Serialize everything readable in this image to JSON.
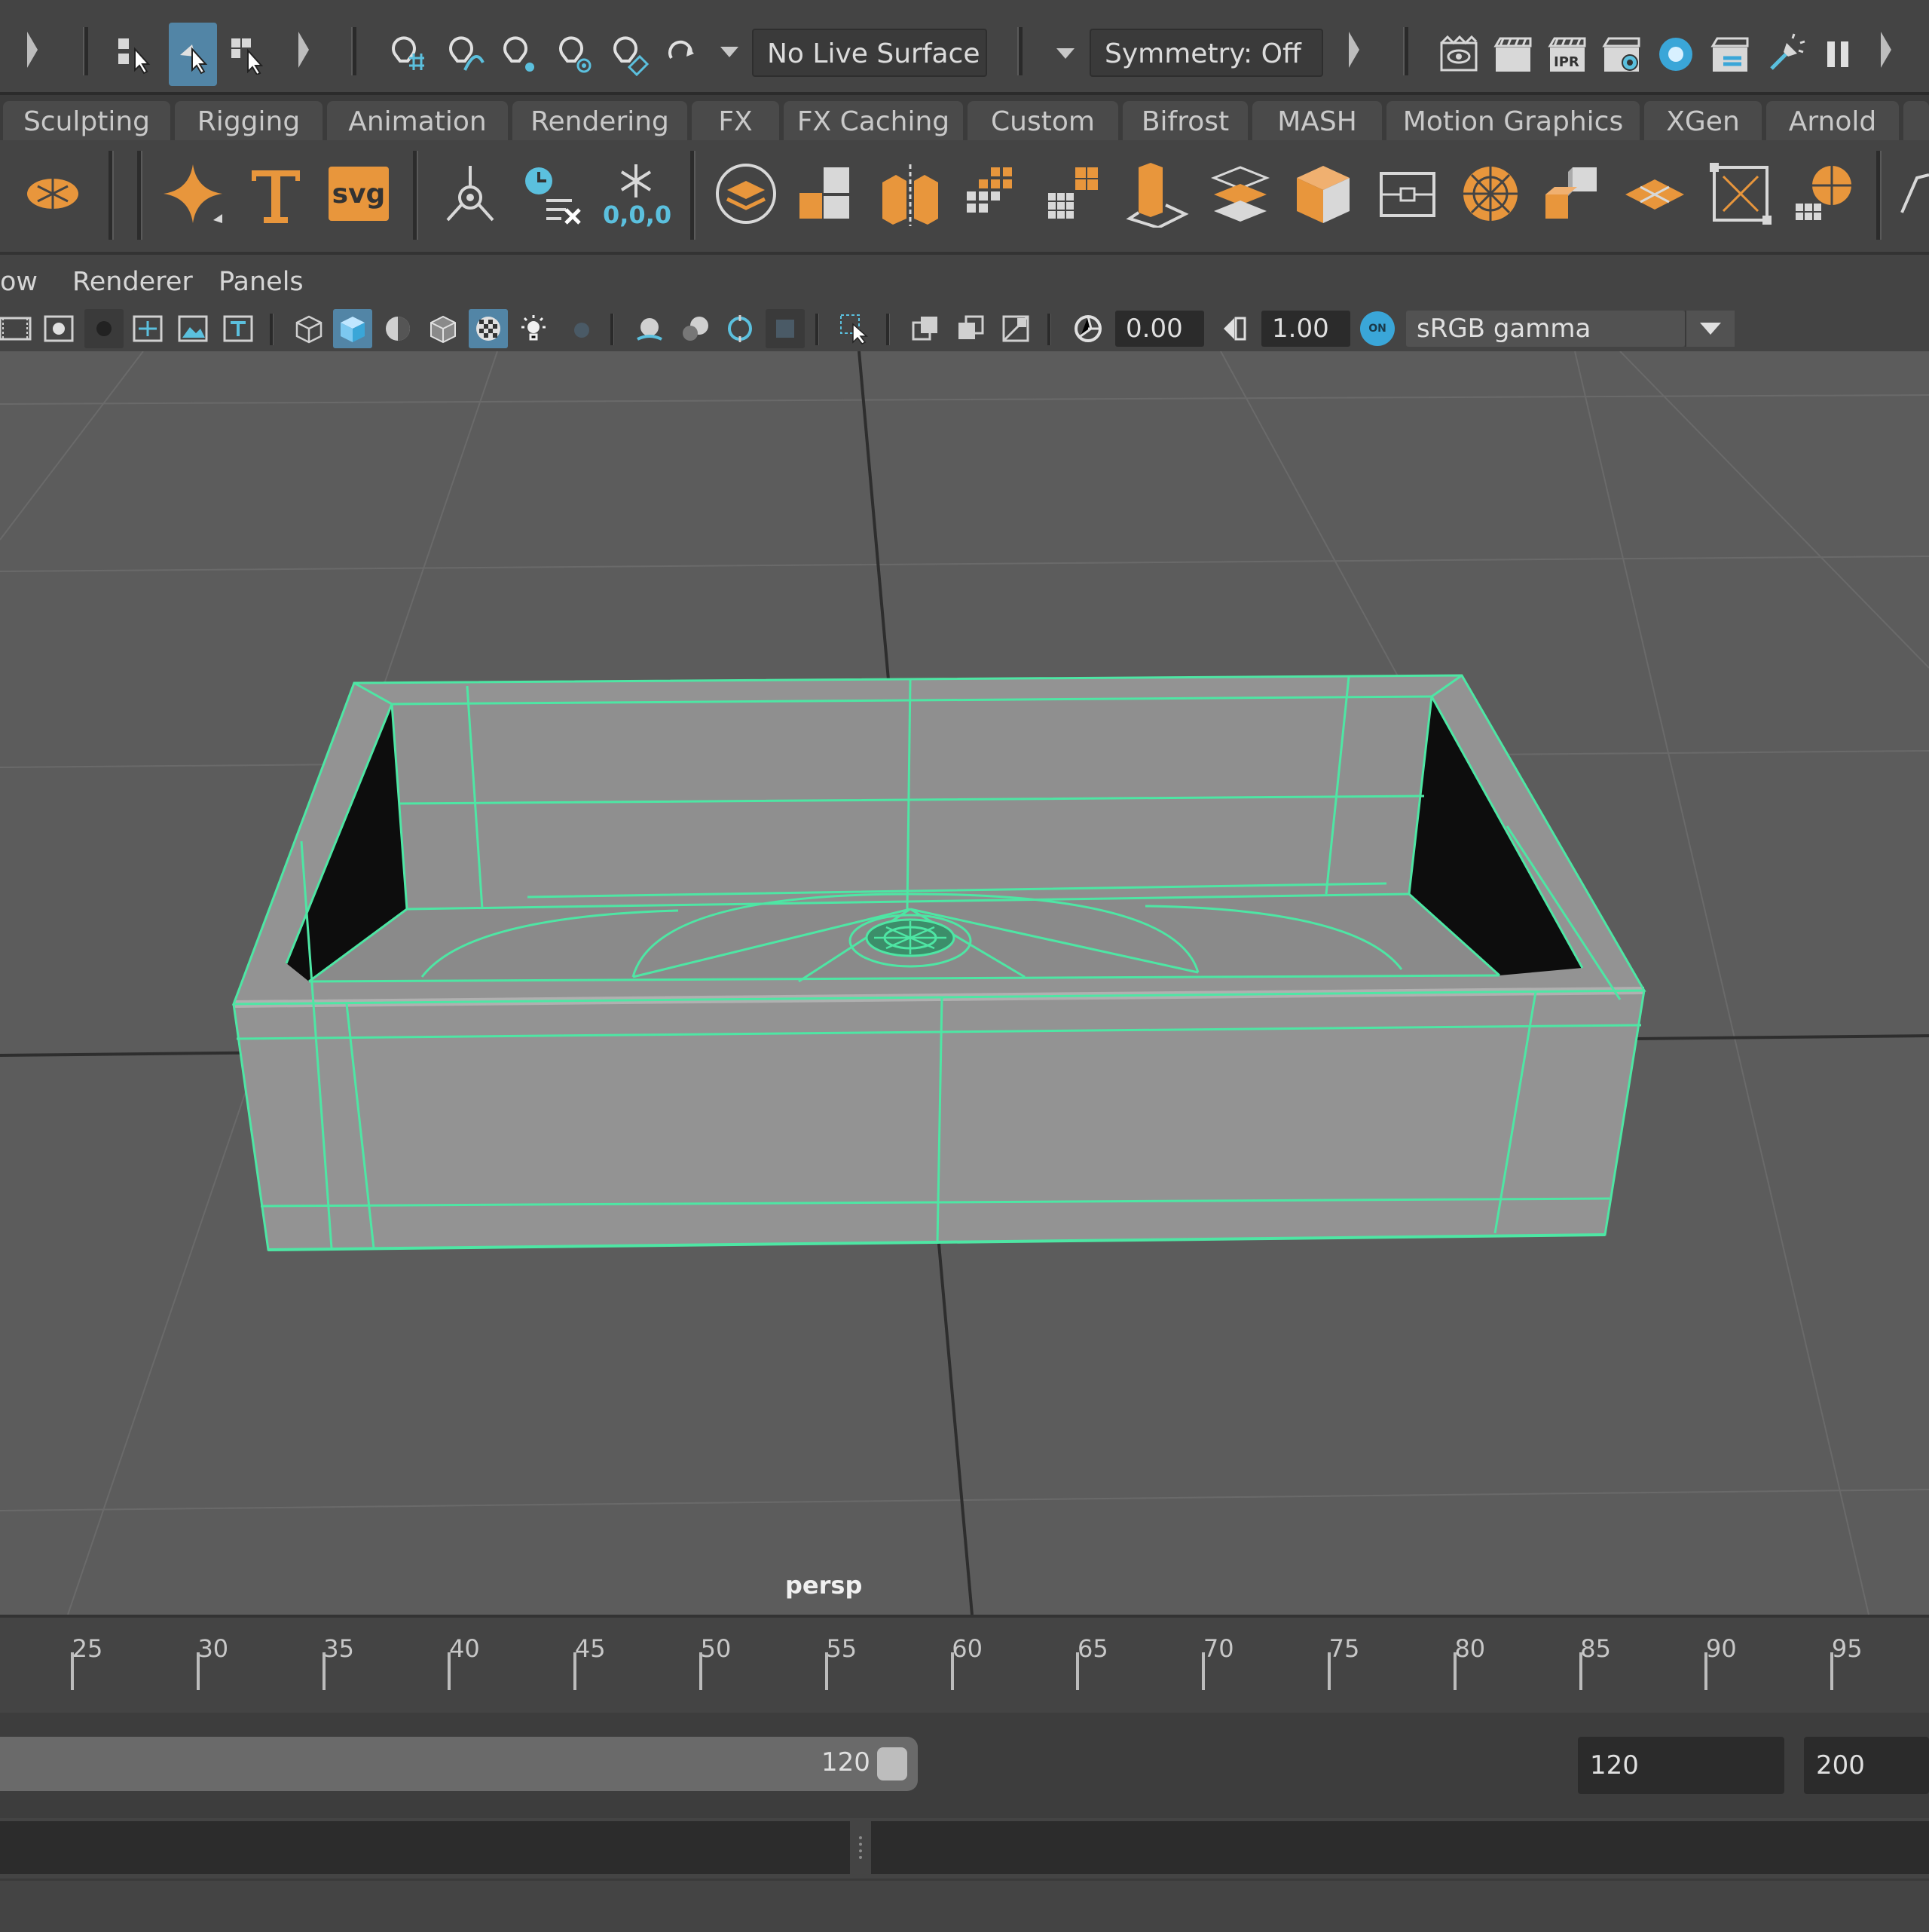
{
  "status_line": {
    "live_surface": "No Live Surface",
    "symmetry": "Symmetry: Off",
    "render_ipr_label": "IPR"
  },
  "shelf_tabs": [
    "Sculpting",
    "Rigging",
    "Animation",
    "Rendering",
    "FX",
    "FX Caching",
    "Custom",
    "Bifrost",
    "MASH",
    "Motion Graphics",
    "XGen",
    "Arnold"
  ],
  "shelf": {
    "svg_label": "svg",
    "snapshot_label": "0,0,0",
    "accent": "#e8963c"
  },
  "panel_menu": {
    "items": [
      "ow",
      "Renderer",
      "Panels"
    ]
  },
  "panel_toolbar": {
    "exposure": "0.00",
    "gamma": "1.00",
    "color_mgmt_label": "ON",
    "view_transform": "sRGB gamma"
  },
  "viewport": {
    "camera": "persp",
    "wire_color": "#4ee6a4",
    "model_color": "#939393",
    "grid_color": "#6a6a6a"
  },
  "time_slider": {
    "tick_labels": [
      "25",
      "30",
      "35",
      "40",
      "45",
      "50",
      "55",
      "60",
      "65",
      "70",
      "75",
      "80",
      "85",
      "90",
      "95"
    ]
  },
  "range_slider": {
    "range_end_handle": "120",
    "playback_end": "120",
    "animation_end": "200"
  }
}
